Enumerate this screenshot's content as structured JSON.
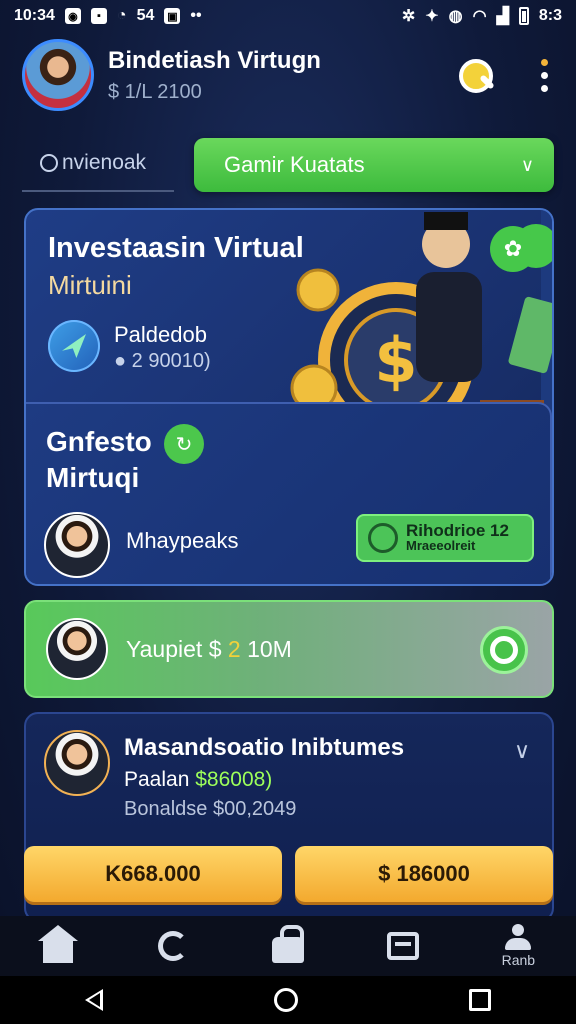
{
  "status_bar": {
    "time": "10:34",
    "left_text": "54",
    "right_text": "8:3"
  },
  "header": {
    "user_name": "Bindetiash Virtugn",
    "balance": "$ 1/L 2100"
  },
  "tabs": {
    "left_tab": "nvienoak",
    "dropdown_label": "Gamir Kuatats"
  },
  "hero_card": {
    "title": "Investaasin Virtual",
    "subtitle": "Mirtuini",
    "product_name": "Paldedob",
    "product_value": "2 90010)"
  },
  "inner_card": {
    "title_line1": "Gnfesto",
    "title_line2": "Mirtuqi",
    "user_name": "Mhaypeaks",
    "tag_title": "Rihodrioe 12",
    "tag_sub": "Mraeeolreit"
  },
  "green_strip": {
    "label": "Yaupiet $",
    "coin": "2",
    "amount": "10M"
  },
  "info_card": {
    "name": "Masandsoatio Inibtumes",
    "line1_label": "Paalan",
    "line1_value": "$86008)",
    "line2": "Bonaldse $00,2049"
  },
  "buttons": {
    "left": "K668.000",
    "right": "$ 186000"
  },
  "bottom_nav": {
    "profile_label": "Ranb"
  },
  "colors": {
    "accent_green": "#4cc74c",
    "gold": "#f3a92e",
    "card_blue": "#1f3d86"
  }
}
